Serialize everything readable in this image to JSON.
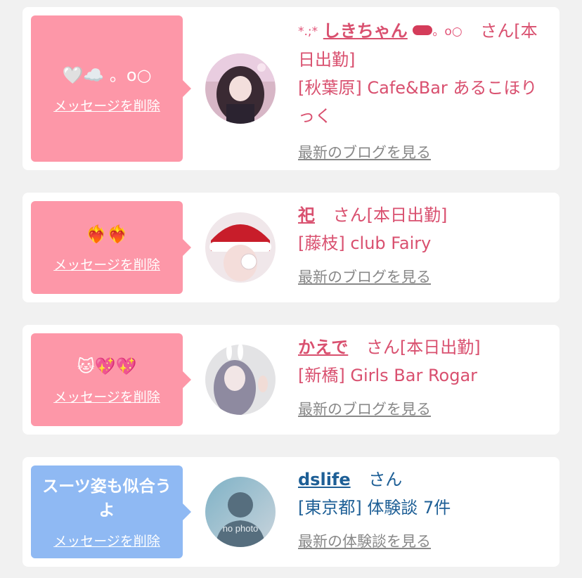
{
  "messages": [
    {
      "bubble_text": "🤍☁️ 。o○",
      "delete_label": "メッセージを削除",
      "name_prefix": "*.;*",
      "name": "しきちゃん",
      "name_suffix": "。o○",
      "honorific": "さん[本日出勤]",
      "shop": "[秋葉原] Cafe&Bar あるこほりっく",
      "link": "最新のブログを見る"
    },
    {
      "bubble_text": "❤️‍🔥❤️‍🔥",
      "delete_label": "メッセージを削除",
      "name": "祀",
      "honorific": "さん[本日出勤]",
      "shop": "[藤枝] club Fairy",
      "link": "最新のブログを見る"
    },
    {
      "bubble_text": "🐱💖💖",
      "delete_label": "メッセージを削除",
      "name": "かえで",
      "honorific": "さん[本日出勤]",
      "shop": "[新橋] Girls Bar Rogar",
      "link": "最新のブログを見る"
    },
    {
      "bubble_text": "スーツ姿も似合うよ",
      "delete_label": "メッセージを削除",
      "name": "dslife",
      "honorific": "さん",
      "shop": "[東京都] 体験談 7件",
      "link": "最新の体験談を見る",
      "avatar_label": "no photo"
    }
  ],
  "colors": {
    "pink_bubble": "#fd97a8",
    "blue_bubble": "#8fb9f3",
    "female_text": "#d9506f",
    "male_text": "#1e5f96",
    "link_gray": "#888888"
  },
  "icons": [
    "white-heart-icon",
    "cloud-icon",
    "heart-on-fire-icon",
    "cat-face-icon",
    "sparkling-heart-icon",
    "avatar-photo",
    "no-photo-avatar"
  ]
}
